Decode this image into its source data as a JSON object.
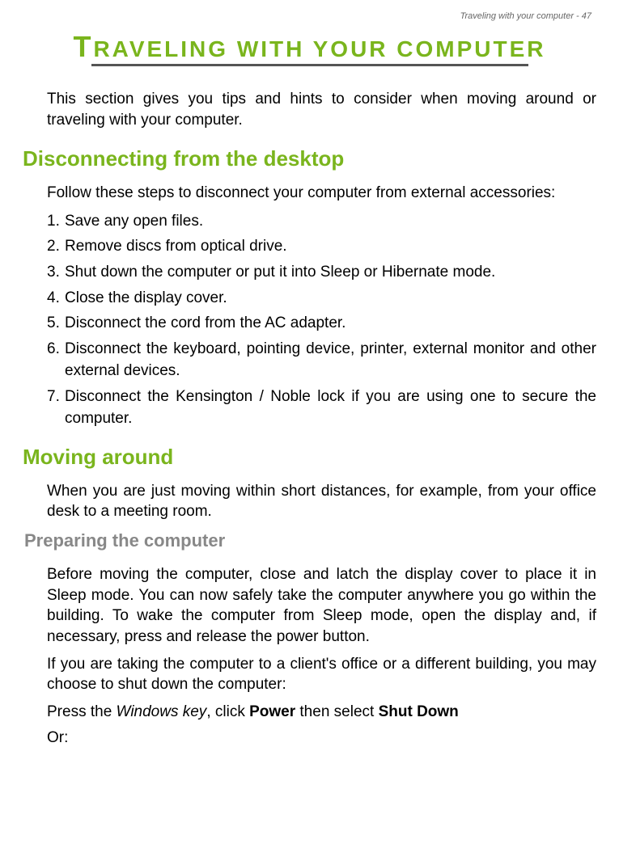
{
  "header": {
    "running": "Traveling with your computer - 47"
  },
  "title": {
    "bigLetter": "T",
    "rest": "RAVELING WITH YOUR COMPUTER"
  },
  "intro": "This section gives you tips and hints to consider when moving around or traveling with your computer.",
  "section1": {
    "heading": "Disconnecting from the desktop",
    "lead": "Follow these steps to disconnect your computer from external accessories:",
    "steps": [
      "Save any open files.",
      "Remove discs from optical drive.",
      "Shut down the computer or put it into Sleep or Hibernate mode.",
      "Close the display cover.",
      "Disconnect the cord from the AC adapter.",
      "Disconnect the keyboard, pointing device, printer, external monitor and other external devices.",
      "Disconnect the Kensington / Noble lock if you are using one to secure the computer."
    ]
  },
  "section2": {
    "heading": "Moving around",
    "lead": "When you are just moving within short distances, for example, from your office desk to a meeting room.",
    "sub1": {
      "heading": "Preparing the computer",
      "p1": "Before moving the computer, close and latch the display cover to place it in Sleep mode. You can now safely take the computer anywhere you go within the building. To wake the computer from Sleep mode, open the display and, if necessary, press and release the power button.",
      "p2": "If you are taking the computer to a client's office or a different building, you may choose to shut down the computer:",
      "instr": {
        "prefix": "Press the ",
        "winkey": "Windows key",
        "mid": ", click ",
        "power": "Power",
        "mid2": " then select ",
        "shutdown": "Shut Down"
      },
      "or": "Or:"
    }
  }
}
